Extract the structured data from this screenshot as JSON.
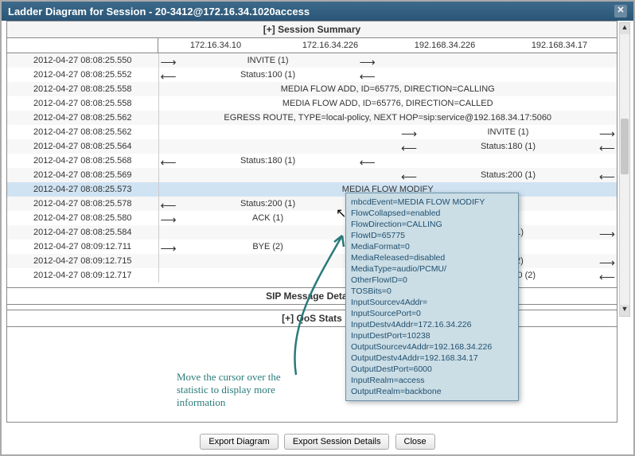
{
  "window": {
    "title": "Ladder Diagram for Session - 20-3412@172.16.34.1020access"
  },
  "summary_header": "[+] Session Summary",
  "hosts": [
    "172.16.34.10",
    "172.16.34.226",
    "192.168.34.226",
    "192.168.34.17"
  ],
  "rows": [
    {
      "ts": "2012-04-27 08:08:25.550",
      "lane": 0,
      "dir": "fwd",
      "label": "INVITE (1)"
    },
    {
      "ts": "2012-04-27 08:08:25.552",
      "lane": 0,
      "dir": "back",
      "label": "Status:100 (1)"
    },
    {
      "ts": "2012-04-27 08:08:25.558",
      "span": true,
      "label": "MEDIA FLOW ADD, ID=65775, DIRECTION=CALLING"
    },
    {
      "ts": "2012-04-27 08:08:25.558",
      "span": true,
      "label": "MEDIA FLOW ADD, ID=65776, DIRECTION=CALLED"
    },
    {
      "ts": "2012-04-27 08:08:25.562",
      "span": true,
      "label": "EGRESS ROUTE, TYPE=local-policy, NEXT HOP=sip:service@192.168.34.17:5060"
    },
    {
      "ts": "2012-04-27 08:08:25.562",
      "lane": 2,
      "dir": "fwd",
      "label": "INVITE (1)"
    },
    {
      "ts": "2012-04-27 08:08:25.564",
      "lane": 2,
      "dir": "back",
      "label": "Status:180 (1)"
    },
    {
      "ts": "2012-04-27 08:08:25.568",
      "lane": 0,
      "dir": "back",
      "label": "Status:180 (1)"
    },
    {
      "ts": "2012-04-27 08:08:25.569",
      "lane": 2,
      "dir": "back",
      "label": "Status:200 (1)"
    },
    {
      "ts": "2012-04-27 08:08:25.573",
      "span": true,
      "label": "MEDIA FLOW MODIFY",
      "selected": true
    },
    {
      "ts": "2012-04-27 08:08:25.578",
      "lane": 0,
      "dir": "back",
      "label": "Status:200 (1)"
    },
    {
      "ts": "2012-04-27 08:08:25.580",
      "lane": 0,
      "dir": "fwd",
      "label": "ACK (1)"
    },
    {
      "ts": "2012-04-27 08:08:25.584",
      "lane": 2,
      "dir": "fwd",
      "label": "ACK (1)"
    },
    {
      "ts": "2012-04-27 08:09:12.711",
      "lane": 0,
      "dir": "fwd",
      "label": "BYE (2)"
    },
    {
      "ts": "2012-04-27 08:09:12.715",
      "lane": 2,
      "dir": "fwd",
      "label": "BYE (2)"
    },
    {
      "ts": "2012-04-27 08:09:12.717",
      "lane": 2,
      "dir": "back",
      "label": "Status:200 (2)"
    }
  ],
  "sip_header": "SIP Message Details",
  "qos_header": "[+] QoS Stats",
  "tooltip_lines": [
    "mbcdEvent=MEDIA FLOW MODIFY",
    "FlowCollapsed=enabled",
    "FlowDirection=CALLING",
    "FlowID=65775",
    "MediaFormat=0",
    "MediaReleased=disabled",
    "MediaType=audio/PCMU/",
    "OtherFlowID=0",
    "TOSBits=0",
    "InputSourcev4Addr=",
    "InputSourcePort=0",
    "InputDestv4Addr=172.16.34.226",
    "InputDestPort=10238",
    "OutputSourcev4Addr=192.168.34.226",
    "OutputDestv4Addr=192.168.34.17",
    "OutputDestPort=6000",
    "InputRealm=access",
    "OutputRealm=backbone"
  ],
  "annotation": "Move the cursor over the\nstatistic to display more\ninformation",
  "buttons": {
    "export_diagram": "Export Diagram",
    "export_details": "Export Session Details",
    "close": "Close"
  }
}
